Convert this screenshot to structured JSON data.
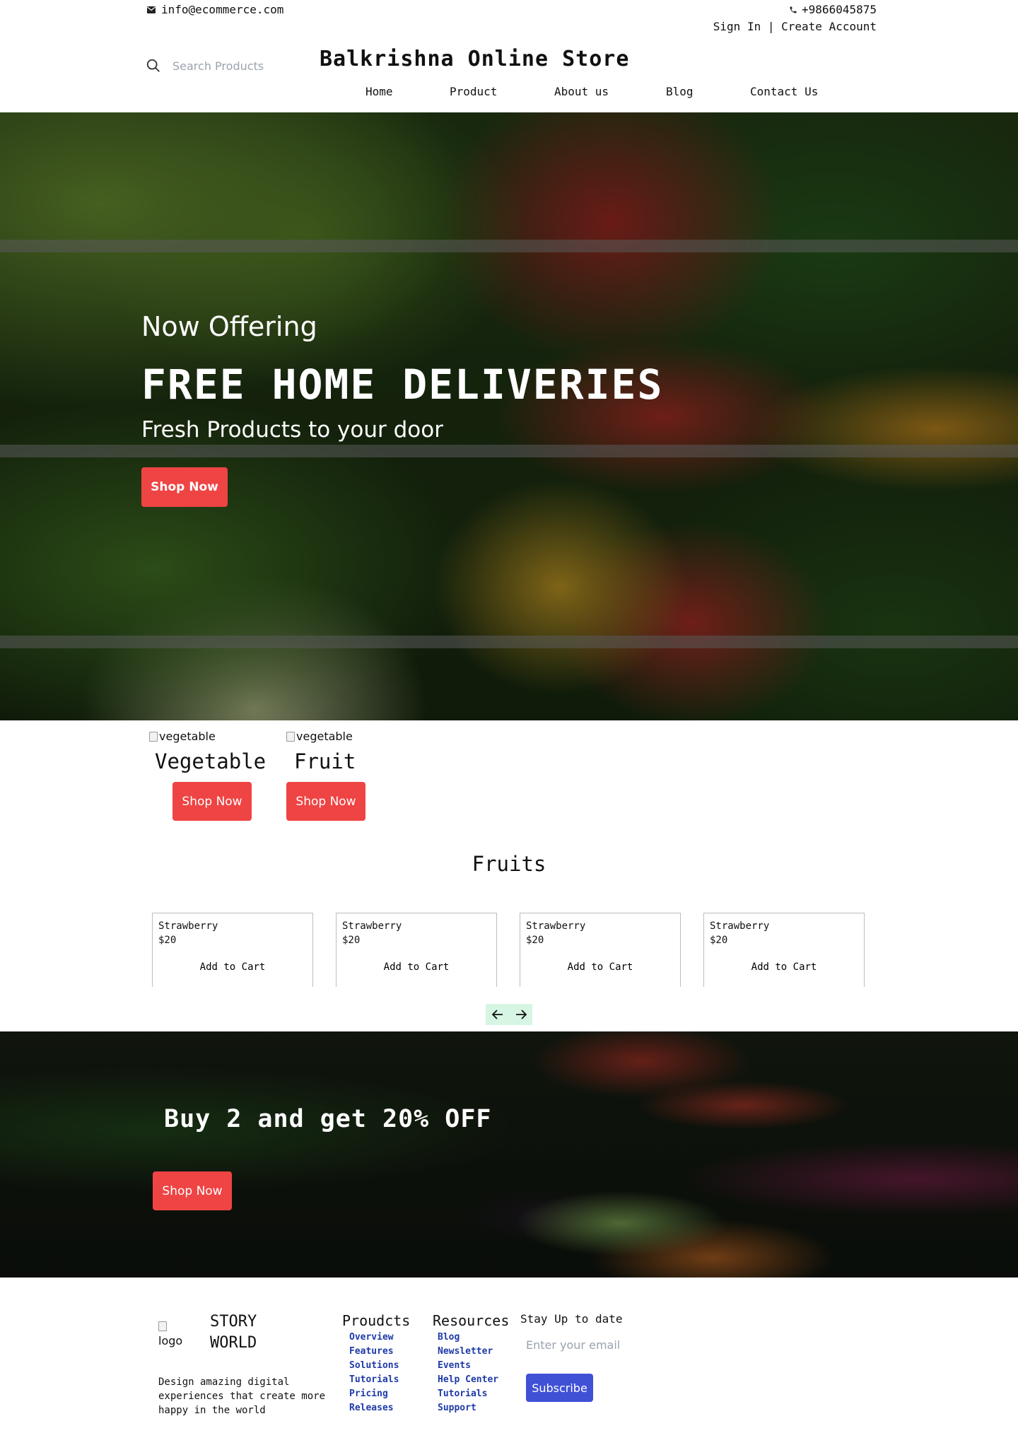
{
  "topbar": {
    "email": "info@ecommerce.com",
    "phone": "+9866045875",
    "sign_in": "Sign In",
    "separator": "|",
    "create_account": "Create Account"
  },
  "header": {
    "search_placeholder": "Search Products",
    "store_title": "Balkrishna Online Store",
    "nav": [
      "Home",
      "Product",
      "About us",
      "Blog",
      "Contact Us"
    ]
  },
  "hero": {
    "subtitle": "Now Offering",
    "title": "FREE HOME DELIVERIES",
    "tagline": "Fresh Products to your door",
    "button": "Shop Now"
  },
  "categories": [
    {
      "img_alt": "vegetable",
      "label": "Vegetable",
      "button": "Shop Now"
    },
    {
      "img_alt": "vegetable",
      "label": "Fruit",
      "button": "Shop Now"
    }
  ],
  "fruits": {
    "title": "Fruits",
    "products": [
      {
        "name": "Strawberry",
        "price": "$20",
        "button": "Add to Cart"
      },
      {
        "name": "Strawberry",
        "price": "$20",
        "button": "Add to Cart"
      },
      {
        "name": "Strawberry",
        "price": "$20",
        "button": "Add to Cart"
      },
      {
        "name": "Strawberry",
        "price": "$20",
        "button": "Add to Cart"
      }
    ]
  },
  "promo": {
    "title": "Buy 2 and get 20% OFF",
    "button": "Shop Now"
  },
  "footer": {
    "logo_alt": "logo",
    "brand_line1": "STORY",
    "brand_line2": "WORLD",
    "description": "Design amazing digital experiences that create more happy in the world",
    "products_title": "Proudcts",
    "products_links": [
      "Overview",
      "Features",
      "Solutions",
      "Tutorials",
      "Pricing",
      "Releases"
    ],
    "resources_title": "Resources",
    "resources_links": [
      "Blog",
      "Newsletter",
      "Events",
      "Help Center",
      "Tutorials",
      "Support"
    ],
    "newsletter_title": "Stay Up to date",
    "email_placeholder": "Enter your email",
    "subscribe": "Subscribe"
  },
  "colors": {
    "accent_red": "#ef4444",
    "subscribe_blue": "#4051d6",
    "link_blue": "#1e3aa8",
    "arrow_bg": "#d6f5e3"
  }
}
